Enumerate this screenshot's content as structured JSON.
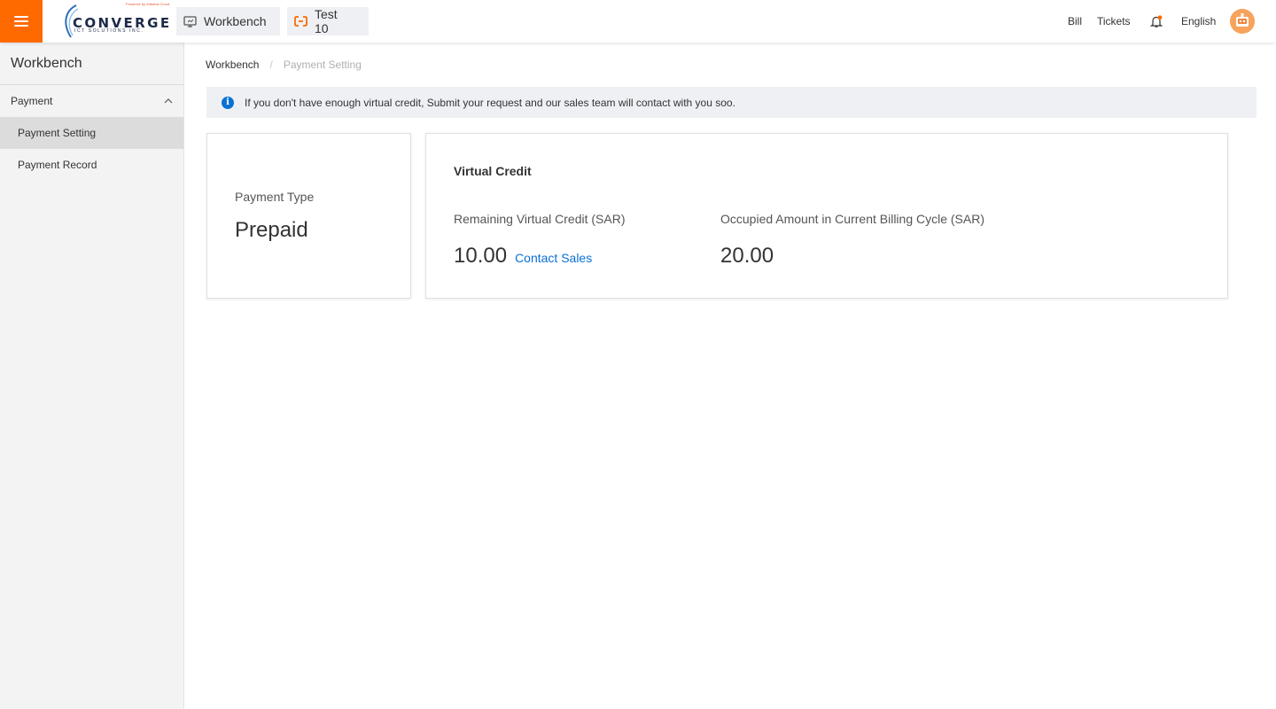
{
  "header": {
    "logo": {
      "brand_name": "CONVERGE",
      "brand_sub": "ICT SOLUTIONS INC.",
      "powered_by": "Powered by Alibaba Cloud"
    },
    "tabs": [
      {
        "label": "Workbench",
        "icon": "monitor-icon"
      },
      {
        "label": "Test 10",
        "icon": "cloud-bracket-icon"
      }
    ],
    "nav": {
      "bill": "Bill",
      "tickets": "Tickets",
      "language": "English"
    },
    "colors": {
      "accent": "#ff6a00",
      "link": "#0a71d4"
    }
  },
  "sidebar": {
    "title": "Workbench",
    "group": {
      "label": "Payment",
      "expanded": true
    },
    "items": [
      {
        "label": "Payment Setting",
        "active": true
      },
      {
        "label": "Payment Record",
        "active": false
      }
    ]
  },
  "breadcrumb": {
    "root": "Workbench",
    "current": "Payment Setting"
  },
  "notice": {
    "text": "If you don't have enough virtual credit, Submit your request and our sales team will contact with you soo."
  },
  "payment_type": {
    "label": "Payment Type",
    "value": "Prepaid"
  },
  "virtual_credit": {
    "title": "Virtual Credit",
    "remaining_label": "Remaining Virtual Credit (SAR)",
    "remaining_value": "10.00",
    "contact_label": "Contact Sales",
    "occupied_label": "Occupied Amount in Current Billing Cycle (SAR)",
    "occupied_value": "20.00"
  }
}
